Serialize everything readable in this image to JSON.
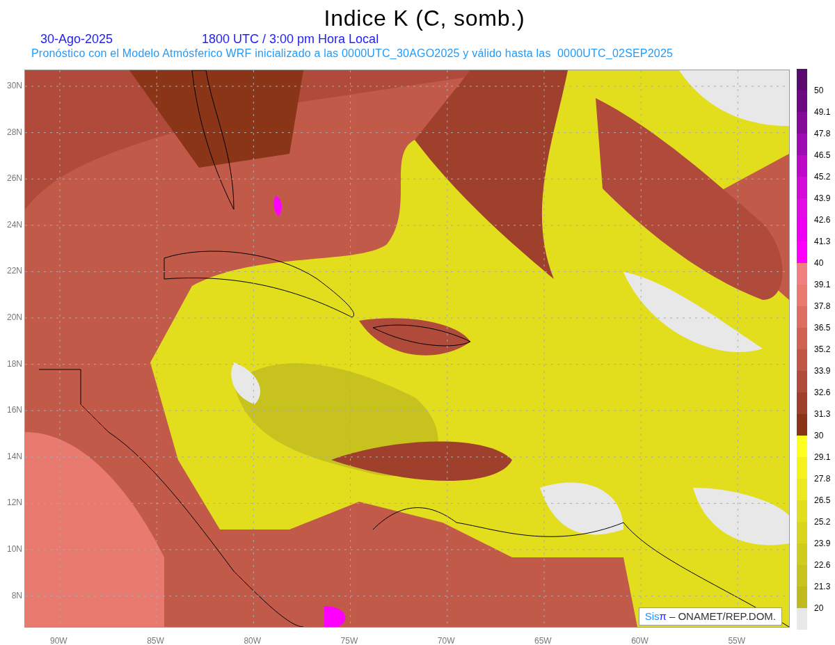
{
  "title": "Indice K (C, somb.)",
  "date": "30-Ago-2025",
  "time": "1800 UTC / 3:00 pm Hora Local",
  "forecast_note": "Pronóstico con el Modelo Atmósferico WRF inicializado a las 0000UTC_30AGO2025 y válido hasta las  0000UTC_02SEP2025",
  "y_axis": [
    "30N",
    "28N",
    "26N",
    "24N",
    "22N",
    "20N",
    "18N",
    "16N",
    "14N",
    "12N",
    "10N",
    "8N"
  ],
  "x_axis": [
    "90W",
    "85W",
    "80W",
    "75W",
    "70W",
    "65W",
    "60W",
    "55W"
  ],
  "legend": [
    {
      "color": "#5a0a6e",
      "label": "50"
    },
    {
      "color": "#6c0a82",
      "label": "49.1"
    },
    {
      "color": "#860a9a",
      "label": "47.8"
    },
    {
      "color": "#a00ab2",
      "label": "46.5"
    },
    {
      "color": "#bc0ac6",
      "label": "45.2"
    },
    {
      "color": "#d40ad8",
      "label": "43.9"
    },
    {
      "color": "#e40ae6",
      "label": "42.6"
    },
    {
      "color": "#f000f2",
      "label": "41.3"
    },
    {
      "color": "#ff00ff",
      "label": "40"
    },
    {
      "color": "#f08080",
      "label": "39.1"
    },
    {
      "color": "#e87a70",
      "label": "37.8"
    },
    {
      "color": "#dc6e62",
      "label": "36.5"
    },
    {
      "color": "#d06254",
      "label": "35.2"
    },
    {
      "color": "#c25646",
      "label": "33.9"
    },
    {
      "color": "#b04a3a",
      "label": "32.6"
    },
    {
      "color": "#9e402c",
      "label": "31.3"
    },
    {
      "color": "#8a3418",
      "label": "30"
    },
    {
      "color": "#ffff20",
      "label": "29.1"
    },
    {
      "color": "#f6f21e",
      "label": "27.8"
    },
    {
      "color": "#ece81e",
      "label": "26.5"
    },
    {
      "color": "#e2de1e",
      "label": "25.2"
    },
    {
      "color": "#d9d51e",
      "label": "23.9"
    },
    {
      "color": "#d0cc1e",
      "label": "22.6"
    },
    {
      "color": "#c7c21e",
      "label": "21.3"
    },
    {
      "color": "#bfba1e",
      "label": "20"
    },
    {
      "color": "#e8e8e8"
    }
  ],
  "credit": {
    "logo_text": "Sis",
    "logo_symbol": "π",
    "text": "– ONAMET/REP.DOM."
  }
}
